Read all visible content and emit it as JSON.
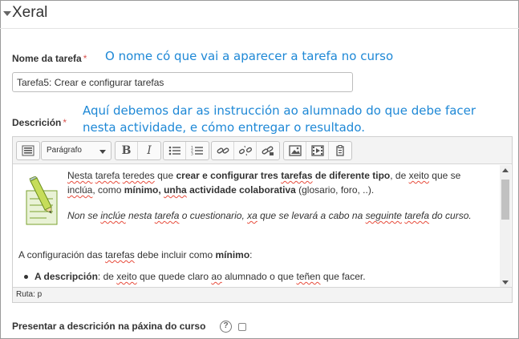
{
  "section": {
    "title": "Xeral"
  },
  "name_field": {
    "label": "Nome da tarefa",
    "required_mark": "*",
    "value": "Tarefa5: Crear e configurar tarefas",
    "annotation": "O nome có que vai a aparecer a tarefa no curso"
  },
  "description_field": {
    "label": "Descrición",
    "required_mark": "*",
    "annotation_line1": "Aquí debemos dar as instrucción ao alumnado do que debe facer",
    "annotation_line2": "nesta actividade, e cómo entregar o resultado."
  },
  "editor": {
    "toolbar": {
      "toggle_icon": "toolbar-toggle-icon",
      "format_select": "Parágrafo",
      "bold": "B",
      "italic": "I"
    },
    "content": {
      "p1": {
        "t1": "Nesta",
        "t2": " ",
        "t3": "tarefa",
        "t4": " ",
        "t5": "teredes",
        "t6": " que ",
        "t7": "crear e configurar tres ",
        "t8": "tarefas",
        "t9": " de diferente tipo",
        "t10": ", de ",
        "t11": "xeito",
        "t12": " que se",
        "t13": "inclúa",
        "t14": ", como ",
        "t15": "mínimo, ",
        "t16": "unha",
        "t17": " actividade colaborativa",
        "t18": " (glosario, foro, ..)."
      },
      "p2": {
        "t1": "Non se ",
        "t2": "inclúe",
        "t3": " nesta ",
        "t4": "tarefa",
        "t5": " o cuestionario, ",
        "t6": "xa",
        "t7": " que se levará a cabo na ",
        "t8": "seguinte",
        "t9": " ",
        "t10": "tarefa",
        "t11": " do curso."
      },
      "p3": {
        "t1": "A configuración das ",
        "t2": "tarefas",
        "t3": " debe incluir como ",
        "t4": "mínimo",
        "t5": ":"
      },
      "p4": {
        "t1": "A descripción",
        "t2": ": de ",
        "t3": "xeito",
        "t4": " que quede claro ",
        "t5": "ao",
        "t6": " alumnado o que ",
        "t7": "teñen",
        "t8": " que facer."
      }
    },
    "status_path": "Ruta: p"
  },
  "show_description": {
    "label": "Presentar a descrición na páxina do curso",
    "help": "?",
    "checked": false
  },
  "colors": {
    "annotation": "#1e88d6",
    "required": "#d9534f"
  }
}
